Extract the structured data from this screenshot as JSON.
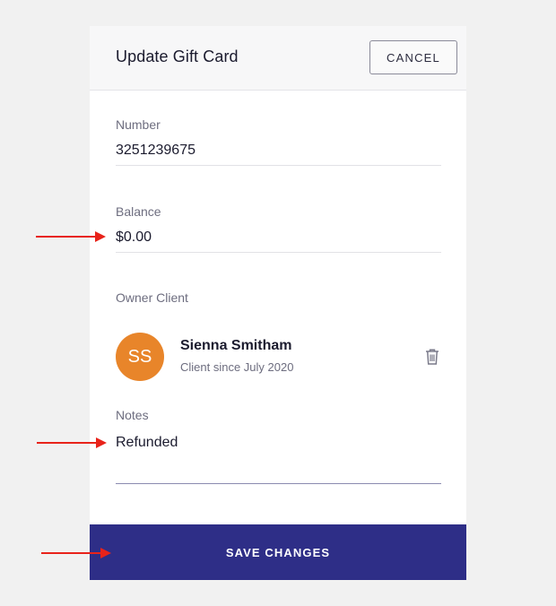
{
  "dialog": {
    "title": "Update Gift Card",
    "cancel_label": "CANCEL",
    "save_label": "SAVE CHANGES"
  },
  "fields": {
    "number": {
      "label": "Number",
      "value": "3251239675"
    },
    "balance": {
      "label": "Balance",
      "value": "$0.00"
    },
    "notes": {
      "label": "Notes",
      "value": "Refunded"
    }
  },
  "owner": {
    "label": "Owner Client",
    "initials": "SS",
    "name": "Sienna Smitham",
    "since": "Client since July 2020"
  },
  "colors": {
    "accent": "#2e2e87",
    "avatar": "#e8852a",
    "annotation_arrow": "#e8231a"
  },
  "icons": [
    "trash-icon",
    "arrow-right-icon"
  ]
}
